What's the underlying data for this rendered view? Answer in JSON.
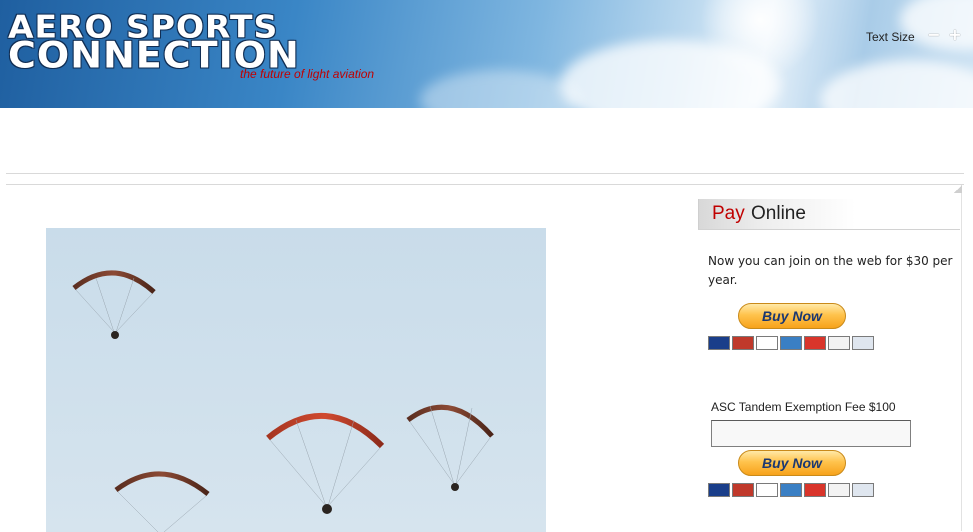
{
  "header": {
    "logo_line1": "AERO SPORTS",
    "logo_line2": "CONNECTION",
    "tagline": "the future of light aviation",
    "text_size_label": "Text Size",
    "text_size_decrease": "−",
    "text_size_increase": "+"
  },
  "sidebar": {
    "module_title_accent": "Pay",
    "module_title_rest": "Online",
    "join_text": "Now you can join on the web for $30 per year.",
    "buy_now_1": "Buy Now",
    "fee_label": "ASC Tandem Exemption Fee $100",
    "fee_input_value": "",
    "buy_now_2": "Buy Now",
    "payment_cards": [
      {
        "name": "Maestro",
        "color": "#1a3e8a"
      },
      {
        "name": "MasterCard",
        "color": "#c0392b"
      },
      {
        "name": "VISA",
        "color": "#ffffff"
      },
      {
        "name": "AmEx",
        "color": "#3a7fc4"
      },
      {
        "name": "ChinaUnionPay",
        "color": "#d9352b"
      },
      {
        "name": "DISCOVER",
        "color": "#f3f3f3"
      },
      {
        "name": "BANK",
        "color": "#dfe6ef"
      }
    ]
  },
  "colors": {
    "accent_red": "#c00000",
    "paypal_button": "#ffc34d",
    "paypal_text": "#1b3872"
  }
}
